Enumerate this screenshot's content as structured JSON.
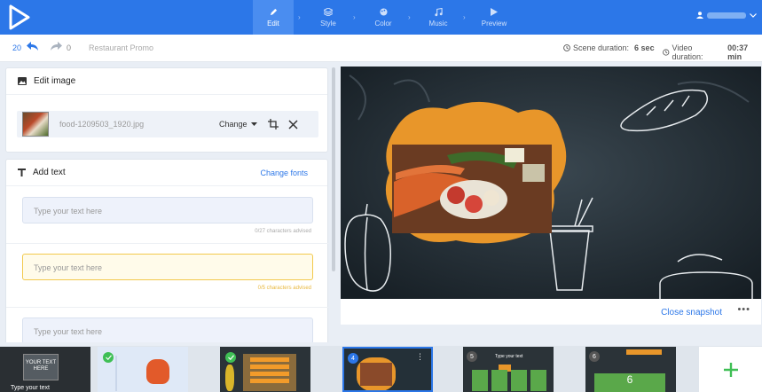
{
  "nav": {
    "steps": [
      {
        "label": "Edit",
        "icon": "pencil-icon",
        "active": true
      },
      {
        "label": "Style",
        "icon": "layers-icon"
      },
      {
        "label": "Color",
        "icon": "palette-icon"
      },
      {
        "label": "Music",
        "icon": "music-note-icon"
      },
      {
        "label": "Preview",
        "icon": "play-icon"
      }
    ]
  },
  "toolbar": {
    "undo_count": "20",
    "redo_count": "0",
    "project_name": "Restaurant Promo",
    "scene_duration_label": "Scene duration:",
    "scene_duration_value": "6 sec",
    "video_duration_label": "Video duration:",
    "video_duration_value": "00:37 min"
  },
  "edit_image": {
    "title": "Edit image",
    "file_name": "food-1209503_1920.jpg",
    "change_label": "Change"
  },
  "add_text": {
    "title": "Add text",
    "change_fonts": "Change fonts",
    "fields": [
      {
        "placeholder": "Type your text here",
        "advise": "0/27 characters advised",
        "warn": false
      },
      {
        "placeholder": "Type your text here",
        "advise": "0/5 characters advised",
        "warn": true
      },
      {
        "placeholder": "Type your text here",
        "advise": "",
        "warn": false
      }
    ]
  },
  "preview": {
    "close_snapshot": "Close snapshot",
    "more": "•••"
  },
  "scenes": [
    {
      "number": "",
      "thumb_text": "YOUR TEXT HERE",
      "caption": "Type your text"
    },
    {
      "number": "",
      "checked": true
    },
    {
      "number": "",
      "checked": true
    },
    {
      "number": "4",
      "selected": true
    },
    {
      "number": "5",
      "caption": "Type your text"
    },
    {
      "number": "6",
      "big": "6"
    }
  ],
  "colors": {
    "brand": "#2c77e8",
    "warning": "#f2c94c",
    "success": "#3fbf55"
  }
}
